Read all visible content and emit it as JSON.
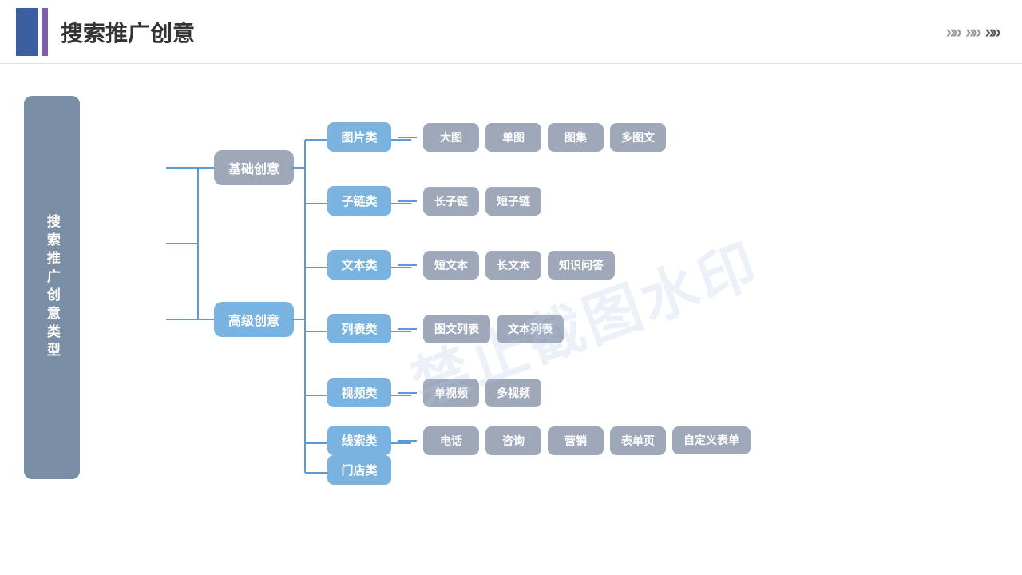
{
  "header": {
    "title": "搜索推广创意",
    "arrows": [
      "»",
      "»",
      "»"
    ]
  },
  "watermark": "禁止截图水印",
  "left_label": "搜索推广创意类型",
  "level1": [
    {
      "id": "basic",
      "label": "基础创意",
      "color": "basic"
    },
    {
      "id": "advanced",
      "label": "高级创意",
      "color": "advanced"
    }
  ],
  "categories": [
    {
      "id": "pic",
      "label": "图片类",
      "subs": [
        "大图",
        "单图",
        "图集",
        "多图文"
      ]
    },
    {
      "id": "sublink",
      "label": "子链类",
      "subs": [
        "长子链",
        "短子链"
      ]
    },
    {
      "id": "text",
      "label": "文本类",
      "subs": [
        "短文本",
        "长文本",
        "知识问答"
      ]
    },
    {
      "id": "list",
      "label": "列表类",
      "subs": [
        "图文列表",
        "文本列表"
      ]
    },
    {
      "id": "video",
      "label": "视频类",
      "subs": [
        "单视频",
        "多视频"
      ]
    },
    {
      "id": "clue",
      "label": "线索类",
      "subs": [
        "电话",
        "咨询",
        "营销",
        "表单页",
        "自定义表单"
      ]
    },
    {
      "id": "store",
      "label": "门店类",
      "subs": []
    }
  ]
}
